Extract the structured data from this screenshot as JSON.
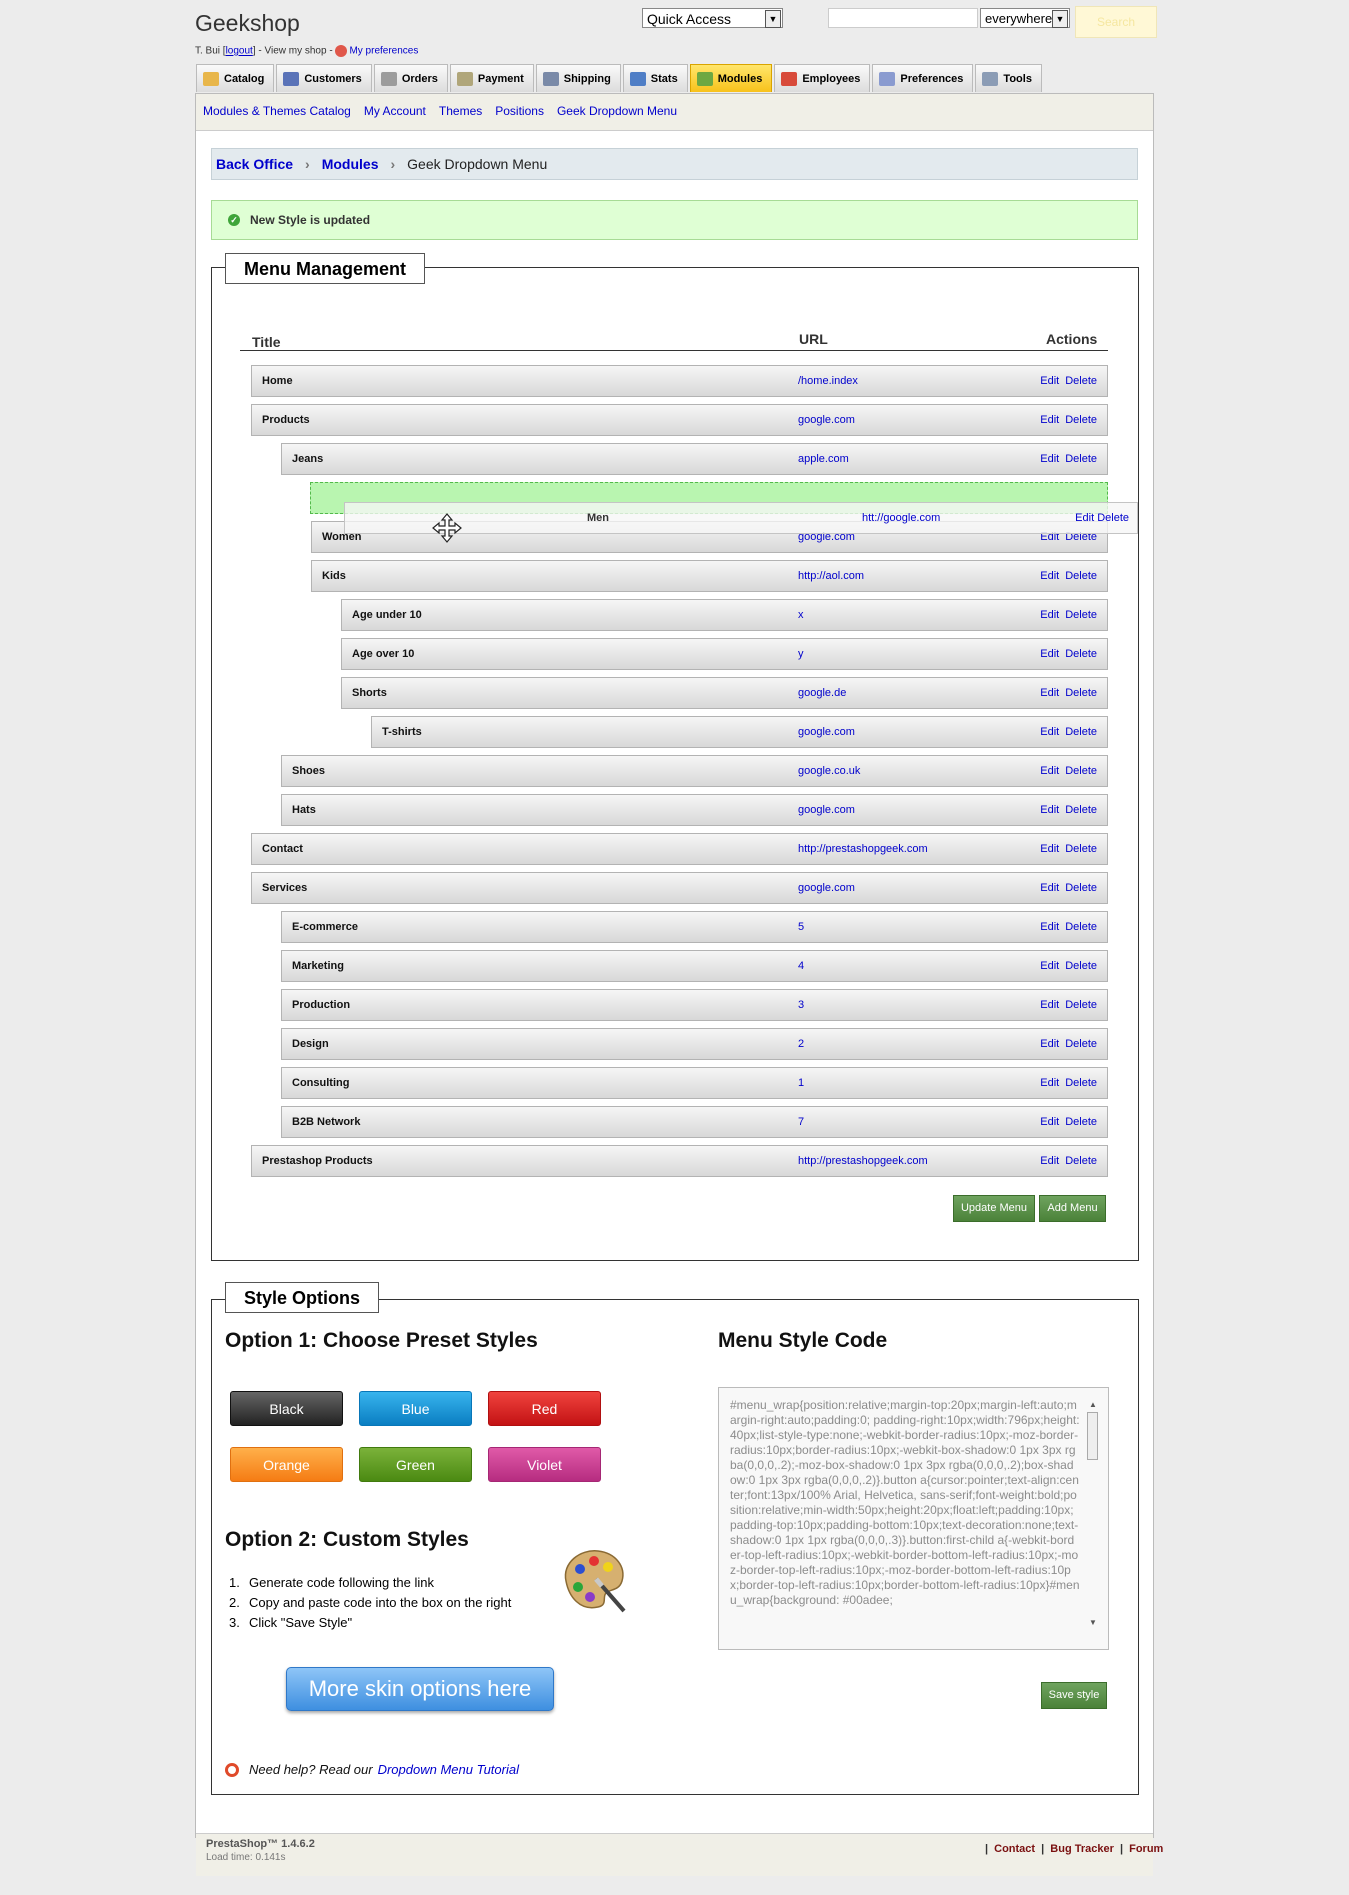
{
  "header": {
    "shop_name": "Geekshop",
    "user_prefix": "T. Bui [",
    "logout": "logout",
    "user_mid": "] - View my shop -",
    "preferences": "My preferences",
    "quick_access": "Quick Access",
    "search_scope": "everywhere",
    "search_button": "Search",
    "search_value": ""
  },
  "tabs": [
    {
      "label": "Catalog",
      "icon_color": "#e8b64a",
      "active": false
    },
    {
      "label": "Customers",
      "icon_color": "#5a73b8",
      "active": false
    },
    {
      "label": "Orders",
      "icon_color": "#9c9c9c",
      "active": false
    },
    {
      "label": "Payment",
      "icon_color": "#b0a67a",
      "active": false
    },
    {
      "label": "Shipping",
      "icon_color": "#7a8aa8",
      "active": false
    },
    {
      "label": "Stats",
      "icon_color": "#4f7ec6",
      "active": false
    },
    {
      "label": "Modules",
      "icon_color": "#6da842",
      "active": true
    },
    {
      "label": "Employees",
      "icon_color": "#d84a3a",
      "active": false
    },
    {
      "label": "Preferences",
      "icon_color": "#8a9bd0",
      "active": false
    },
    {
      "label": "Tools",
      "icon_color": "#8b9cb5",
      "active": false
    }
  ],
  "subnav": [
    "Modules & Themes Catalog",
    "My Account",
    "Themes",
    "Positions",
    "Geek Dropdown Menu"
  ],
  "breadcrumb": {
    "home": "Back Office",
    "section": "Modules",
    "current": "Geek Dropdown Menu"
  },
  "message": "New Style is updated",
  "menu": {
    "legend": "Menu Management",
    "col_title": "Title",
    "col_url": "URL",
    "col_actions": "Actions",
    "edit": "Edit",
    "delete": "Delete",
    "rows": [
      {
        "title": "Home",
        "url": "/home.index",
        "level": 0
      },
      {
        "title": "Products",
        "url": "google.com",
        "level": 0
      },
      {
        "title": "Jeans",
        "url": "apple.com",
        "level": 1
      },
      {
        "title": "Women",
        "url": "google.com",
        "level": 2
      },
      {
        "title": "Kids",
        "url": "http://aol.com",
        "level": 2
      },
      {
        "title": "Age under 10",
        "url": "x",
        "level": 3
      },
      {
        "title": "Age over 10",
        "url": "y",
        "level": 3
      },
      {
        "title": "Shorts",
        "url": "google.de",
        "level": 3
      },
      {
        "title": "T-shirts",
        "url": "google.com",
        "level": 4
      },
      {
        "title": "Shoes",
        "url": "google.co.uk",
        "level": 1
      },
      {
        "title": "Hats",
        "url": "google.com",
        "level": 1
      },
      {
        "title": "Contact",
        "url": "http://prestashopgeek.com",
        "level": 0
      },
      {
        "title": "Services",
        "url": "google.com",
        "level": 0
      },
      {
        "title": "E-commerce",
        "url": "5",
        "level": 1
      },
      {
        "title": "Marketing",
        "url": "4",
        "level": 1
      },
      {
        "title": "Production",
        "url": "3",
        "level": 1
      },
      {
        "title": "Design",
        "url": "2",
        "level": 1
      },
      {
        "title": "Consulting",
        "url": "1",
        "level": 1
      },
      {
        "title": "B2B Network",
        "url": "7",
        "level": 1
      },
      {
        "title": "Prestashop Products",
        "url": "http://prestashopgeek.com",
        "level": 0
      }
    ],
    "dragging": {
      "title": "Men",
      "url": "htt://google.com"
    },
    "update_button": "Update Menu",
    "add_button": "Add Menu"
  },
  "style": {
    "legend": "Style Options",
    "option1_title": "Option 1: Choose Preset Styles",
    "presets": [
      "Black",
      "Blue",
      "Red",
      "Orange",
      "Green",
      "Violet"
    ],
    "option2_title": "Option 2: Custom Styles",
    "steps": [
      "Generate code following the link",
      "Copy and paste code into the box on the right",
      "Click \"Save Style\""
    ],
    "more_skins": "More skin options here",
    "help_prefix": "Need help? Read our",
    "help_link": "Dropdown Menu Tutorial",
    "code_title": "Menu Style Code",
    "code": "#menu_wrap{position:relative;margin-top:20px;margin-left:auto;margin-right:auto;padding:0; padding-right:10px;width:796px;height:40px;list-style-type:none;-webkit-border-radius:10px;-moz-border-radius:10px;border-radius:10px;-webkit-box-shadow:0 1px 3px rgba(0,0,0,.2);-moz-box-shadow:0 1px 3px rgba(0,0,0,.2);box-shadow:0 1px 3px rgba(0,0,0,.2)}.button a{cursor:pointer;text-align:center;font:13px/100% Arial, Helvetica, sans-serif;font-weight:bold;position:relative;min-width:50px;height:20px;float:left;padding:10px;padding-top:10px;padding-bottom:10px;text-decoration:none;text-shadow:0 1px 1px rgba(0,0,0,.3)}.button:first-child a{-webkit-border-top-left-radius:10px;-webkit-border-bottom-left-radius:10px;-moz-border-top-left-radius:10px;-moz-border-bottom-left-radius:10px;border-top-left-radius:10px;border-bottom-left-radius:10px}#menu_wrap{background: #00adee;",
    "save_button": "Save style"
  },
  "footer": {
    "version": "PrestaShop™ 1.4.6.2",
    "load_time": "Load time: 0.141s",
    "links": [
      "Contact",
      "Bug Tracker",
      "Forum"
    ]
  }
}
